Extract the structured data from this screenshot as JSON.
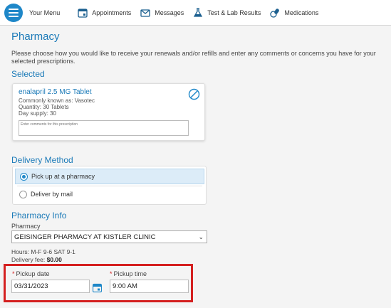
{
  "nav": {
    "menu_label": "Your Menu",
    "items": [
      {
        "label": "Appointments",
        "icon": "calendar-icon"
      },
      {
        "label": "Messages",
        "icon": "envelope-icon"
      },
      {
        "label": "Test & Lab Results",
        "icon": "flask-icon"
      },
      {
        "label": "Medications",
        "icon": "pill-icon"
      }
    ]
  },
  "page": {
    "title": "Pharmacy",
    "intro": "Please choose how you would like to receive your renewals and/or refills and enter any comments or concerns you have for your selected prescriptions."
  },
  "selected": {
    "heading": "Selected",
    "medication": {
      "name": "enalapril 2.5 MG Tablet",
      "common_name": "Commonly known as: Vasotec",
      "quantity": "Quantity: 30 Tablets",
      "day_supply": "Day supply: 30",
      "comment_placeholder": "Enter comments for this prescription"
    }
  },
  "delivery": {
    "heading": "Delivery Method",
    "options": [
      {
        "label": "Pick up at a pharmacy",
        "selected": true
      },
      {
        "label": "Deliver by mail",
        "selected": false
      }
    ]
  },
  "pharmacy_info": {
    "heading": "Pharmacy Info",
    "pharmacy_label": "Pharmacy",
    "pharmacy_value": "GEISINGER PHARMACY AT KISTLER CLINIC",
    "hours": "Hours: M-F 9-6 SAT 9-1",
    "delivery_fee_label": "Delivery fee: ",
    "delivery_fee_value": "$0.00"
  },
  "pickup": {
    "date_label": "Pickup date",
    "date_value": "03/31/2023",
    "time_label": "Pickup time",
    "time_value": "9:00 AM",
    "required_mark": "*"
  },
  "colors": {
    "brand_blue": "#1b7ab8",
    "menu_blue": "#1e87c8",
    "highlight_red": "#d42020",
    "selected_bg": "#dcecf8"
  }
}
